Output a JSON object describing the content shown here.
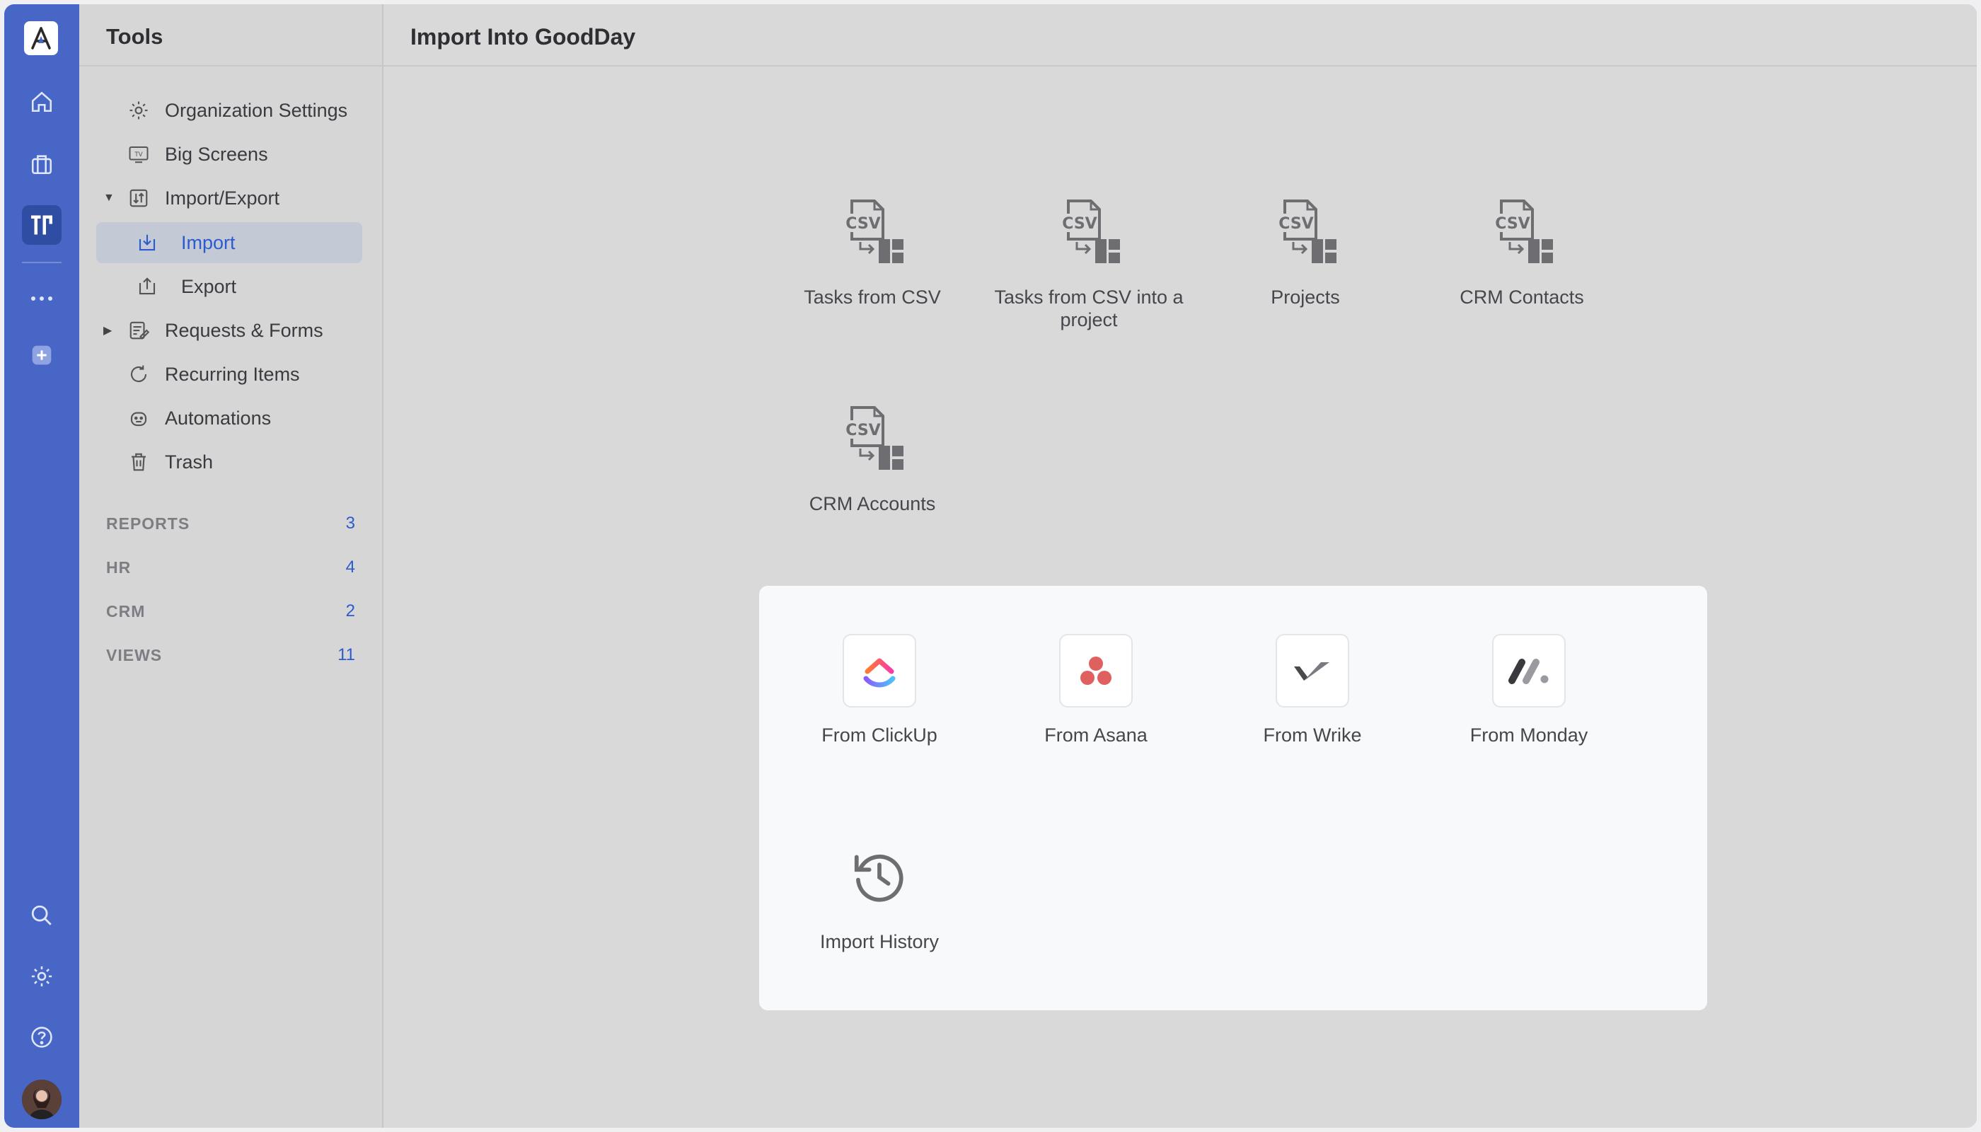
{
  "rail": {
    "logo_icon": "goodday-logo",
    "items": [
      "home-icon",
      "briefcase-icon",
      "tools-icon",
      "more-icon",
      "add-icon"
    ],
    "bottom": [
      "search-icon",
      "gear-icon",
      "help-icon",
      "avatar"
    ]
  },
  "sidebar": {
    "title": "Tools",
    "items": [
      {
        "label": "Organization Settings",
        "icon": "gear-icon"
      },
      {
        "label": "Big Screens",
        "icon": "tv-icon"
      },
      {
        "label": "Import/Export",
        "icon": "import-export-icon"
      },
      {
        "label": "Import",
        "icon": "import-icon"
      },
      {
        "label": "Export",
        "icon": "export-icon"
      },
      {
        "label": "Requests & Forms",
        "icon": "form-icon"
      },
      {
        "label": "Recurring Items",
        "icon": "recurring-icon"
      },
      {
        "label": "Automations",
        "icon": "robot-icon"
      },
      {
        "label": "Trash",
        "icon": "trash-icon"
      }
    ],
    "sections": [
      {
        "label": "REPORTS",
        "count": "3"
      },
      {
        "label": "HR",
        "count": "4"
      },
      {
        "label": "CRM",
        "count": "2"
      },
      {
        "label": "VIEWS",
        "count": "11"
      }
    ]
  },
  "main": {
    "title": "Import Into GoodDay",
    "csv_icon_text": "CSV",
    "csv_tiles": [
      {
        "label": "Tasks from CSV"
      },
      {
        "label": "Tasks from CSV into a project"
      },
      {
        "label": "Projects"
      },
      {
        "label": "CRM Contacts"
      },
      {
        "label": "CRM Accounts"
      }
    ],
    "app_tiles": [
      {
        "label": "From ClickUp",
        "icon": "clickup-icon"
      },
      {
        "label": "From Asana",
        "icon": "asana-icon"
      },
      {
        "label": "From Wrike",
        "icon": "wrike-icon"
      },
      {
        "label": "From Monday",
        "icon": "monday-icon"
      }
    ],
    "history": {
      "label": "Import History",
      "icon": "history-icon"
    }
  },
  "colors": {
    "rail": "#4766c6",
    "accent": "#2c5bd0",
    "sidebar_bg": "#d6d6d6",
    "main_bg": "#d9d9d9",
    "panel_bg": "#f8f9fa"
  }
}
